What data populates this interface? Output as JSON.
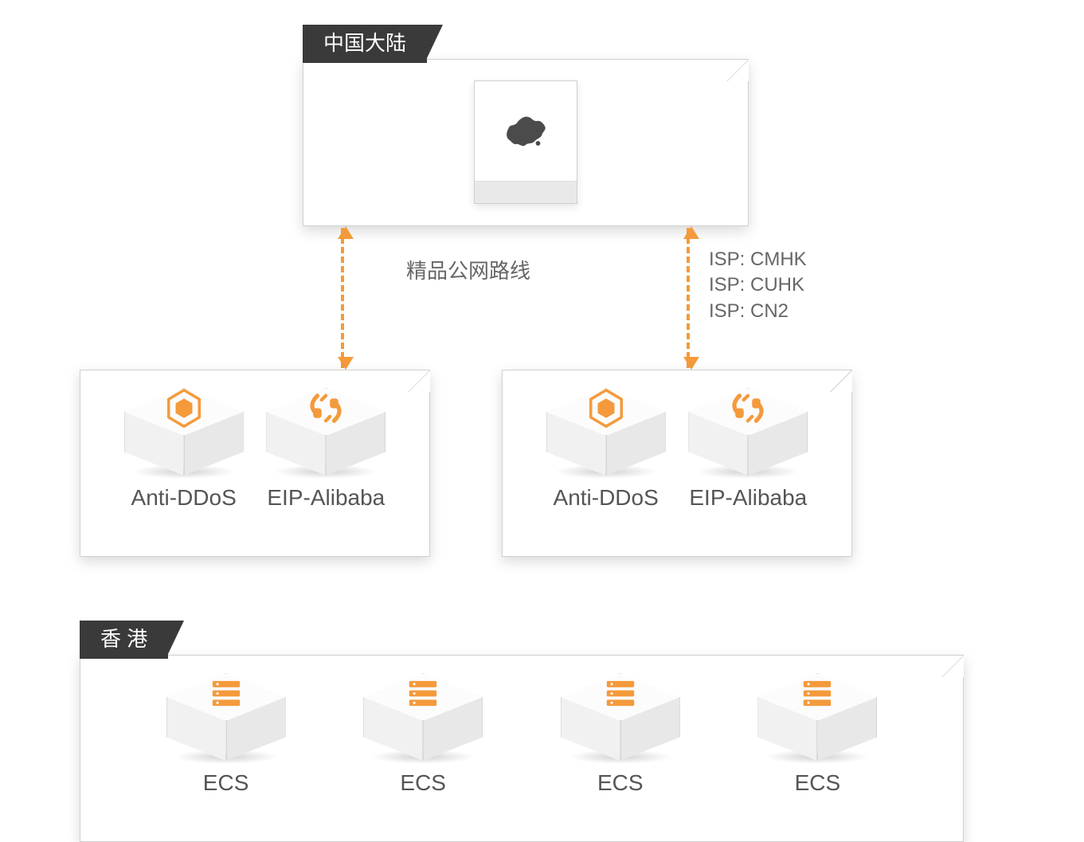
{
  "regions": {
    "china": {
      "title": "中国大陆"
    },
    "hongkong": {
      "title": "香 港"
    }
  },
  "connections": {
    "premium_line_label": "精品公网路线",
    "isp_lines": {
      "0": "ISP: CMHK",
      "1": "ISP: CUHK",
      "2": "ISP: CN2"
    }
  },
  "nodes": {
    "anti_ddos": {
      "label": "Anti-DDoS"
    },
    "eip": {
      "label": "EIP-Alibaba"
    },
    "ecs": {
      "label": "ECS"
    }
  },
  "colors": {
    "accent": "#f49a3b",
    "tab_bg": "#3a3a3a"
  }
}
